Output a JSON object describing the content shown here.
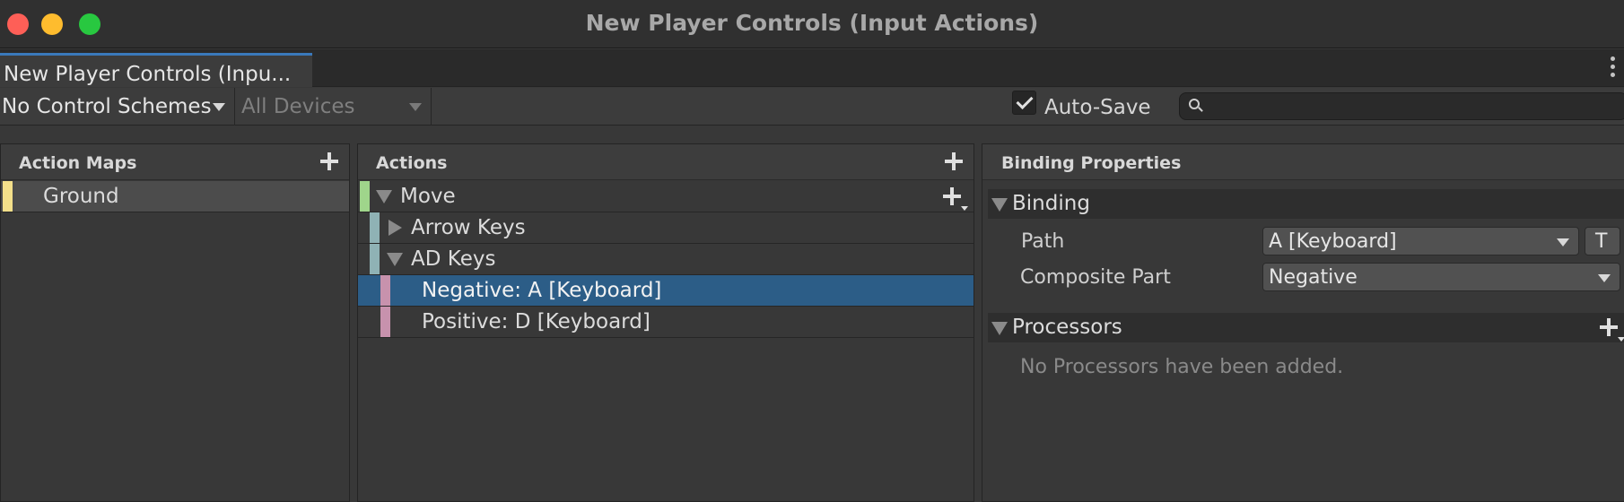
{
  "window": {
    "title": "New Player  Controls (Input Actions)"
  },
  "tab": {
    "label": "New Player  Controls (Inpu..."
  },
  "toolbar": {
    "control_scheme": "No Control Schemes",
    "devices": "All Devices",
    "autosave_label": "Auto-Save",
    "autosave_checked": true,
    "search_value": ""
  },
  "action_maps": {
    "header": "Action Maps",
    "items": [
      {
        "label": "Ground",
        "selected": true,
        "color": "#f3df8a"
      }
    ]
  },
  "actions": {
    "header": "Actions",
    "items": [
      {
        "label": "Move",
        "expanded": true,
        "color": "#9fd58b"
      },
      {
        "label": "Arrow Keys",
        "expanded": false,
        "color": "#8fb2b5"
      },
      {
        "label": "AD Keys",
        "expanded": true,
        "color": "#8fb2b5"
      },
      {
        "label": "Negative: A [Keyboard]",
        "selected": true,
        "color": "#c792ad"
      },
      {
        "label": "Positive: D [Keyboard]",
        "selected": false,
        "color": "#c792ad"
      }
    ]
  },
  "binding_properties": {
    "header": "Binding Properties",
    "binding_section": "Binding",
    "path_label": "Path",
    "path_value": "A [Keyboard]",
    "text_mode_button": "T",
    "composite_label": "Composite Part",
    "composite_value": "Negative",
    "processors_section": "Processors",
    "processors_empty": "No Processors have been added."
  },
  "colors": {
    "selection": "#2c5d87",
    "accent": "#3a79bb"
  }
}
